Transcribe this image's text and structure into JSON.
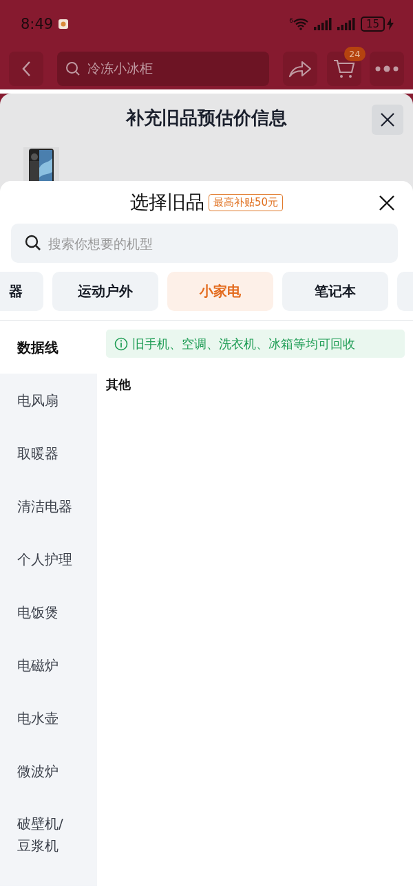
{
  "status_bar": {
    "time": "8:49",
    "wifi_label": "6",
    "battery": "15",
    "charging": true
  },
  "nav": {
    "search_query": "冷冻小冰柜",
    "cart_count": "24"
  },
  "estimate_sheet": {
    "title": "补充旧品预估价信息"
  },
  "picker": {
    "title": "选择旧品",
    "badge": "最高补贴50元",
    "search": {
      "placeholder": "搜索你想要的机型"
    },
    "tabs": [
      {
        "label": "器",
        "selected": false
      },
      {
        "label": "运动户外",
        "selected": false
      },
      {
        "label": "小家电",
        "selected": true
      },
      {
        "label": "笔记本",
        "selected": false
      },
      {
        "selected": false
      }
    ],
    "sidebar": {
      "items": [
        {
          "label": "数据线",
          "selected": true
        },
        {
          "label": "电风扇",
          "selected": false
        },
        {
          "label": "取暖器",
          "selected": false
        },
        {
          "label": "清洁电器",
          "selected": false
        },
        {
          "label": "个人护理",
          "selected": false
        },
        {
          "label": "电饭煲",
          "selected": false
        },
        {
          "label": "电磁炉",
          "selected": false
        },
        {
          "label": "电水壶",
          "selected": false
        },
        {
          "label": "微波炉",
          "selected": false
        },
        {
          "label": "破壁机/\n豆浆机",
          "selected": false
        }
      ]
    },
    "notice": "旧手机、空调、洗衣机、冰箱等均可回收",
    "section_title": "其他"
  }
}
